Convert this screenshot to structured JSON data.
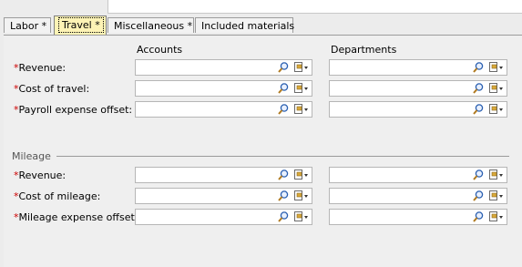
{
  "tabs": [
    {
      "label": "Labor *"
    },
    {
      "label": "Travel *"
    },
    {
      "label": "Miscellaneous *"
    },
    {
      "label": "Included materials"
    }
  ],
  "columns": {
    "accounts": "Accounts",
    "departments": "Departments"
  },
  "travel_rows": [
    {
      "required": "*",
      "label": "Revenue:",
      "account": "",
      "department": ""
    },
    {
      "required": "*",
      "label": "Cost of travel:",
      "account": "",
      "department": ""
    },
    {
      "required": "*",
      "label": "Payroll expense offset:",
      "account": "",
      "department": ""
    }
  ],
  "mileage_group": {
    "label": "Mileage"
  },
  "mileage_rows": [
    {
      "required": "*",
      "label": "Revenue:",
      "account": "",
      "department": ""
    },
    {
      "required": "*",
      "label": "Cost of mileage:",
      "account": "",
      "department": ""
    },
    {
      "required": "*",
      "label": "Mileage expense offset:",
      "account": "",
      "department": ""
    }
  ],
  "icons": {
    "lookup": "magnifier-icon",
    "link": "document-link-dropdown-icon"
  },
  "colors": {
    "required": "#cc0000",
    "active_tab": "#fdf3b5"
  }
}
